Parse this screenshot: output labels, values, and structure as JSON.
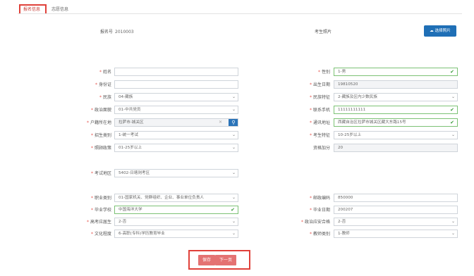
{
  "tabs": [
    "报名信息",
    "志愿信息"
  ],
  "registration": {
    "label": "报名号",
    "value": "2010003"
  },
  "photo": {
    "label": "考生照片",
    "button": "选择照片"
  },
  "left_fields": [
    {
      "label": "姓名",
      "required": true,
      "value": ""
    },
    {
      "label": "身份证",
      "required": true,
      "value": ""
    },
    {
      "label": "民族",
      "required": true,
      "value": "04-藏族"
    },
    {
      "label": "政治面貌",
      "required": true,
      "value": "01-中共党员"
    },
    {
      "label": "户籍所在地",
      "required": true,
      "value": "拉萨市-城关区"
    },
    {
      "label": "招生类别",
      "required": true,
      "value": "1-统一考试"
    },
    {
      "label": "照顾政策",
      "required": true,
      "value": "01-25岁以上"
    }
  ],
  "right_fields": [
    {
      "label": "性别",
      "required": true,
      "value": "1-男"
    },
    {
      "label": "出生日期",
      "required": true,
      "value": "19810520"
    },
    {
      "label": "民族特征",
      "required": true,
      "value": "2-藏族及区内少数民族"
    },
    {
      "label": "联系手机",
      "required": true,
      "value": "11111111111"
    },
    {
      "label": "通讯地址",
      "required": true,
      "value": "西藏自治区拉萨市城关区藏大东路15号"
    },
    {
      "label": "考生特征",
      "required": true,
      "value": "10-25岁以上"
    },
    {
      "label": "资格加分",
      "required": false,
      "value": "20"
    }
  ],
  "exam_area": {
    "label": "考试地区",
    "required": true,
    "value": "5402-日喀则考区"
  },
  "bottom_left": [
    {
      "label": "职业类别",
      "required": true,
      "value": "01-国家机关、党群组织、企业、事业单位负责人"
    },
    {
      "label": "毕业学校",
      "required": true,
      "value": "中国海洋大学"
    },
    {
      "label": "高考应届生",
      "required": true,
      "value": "2-否"
    },
    {
      "label": "文化程度",
      "required": true,
      "value": "6-高职(专科)学历教育毕业"
    }
  ],
  "bottom_right": [
    {
      "label": "邮政编码",
      "required": true,
      "value": "850000"
    },
    {
      "label": "毕业日期",
      "required": true,
      "value": "200207"
    },
    {
      "label": "政治应安合格",
      "required": true,
      "value": "2-否"
    },
    {
      "label": "教师类别",
      "required": true,
      "value": "1-教师"
    }
  ],
  "buttons": {
    "save": "保存",
    "next": "下一页"
  },
  "colors": {
    "primary": "#1f6fb6",
    "danger": "#e0413a",
    "success": "#3a9d3a"
  },
  "icons": [
    "search-icon",
    "check-icon",
    "chevron-down-icon",
    "camera-icon",
    "clear-icon"
  ]
}
